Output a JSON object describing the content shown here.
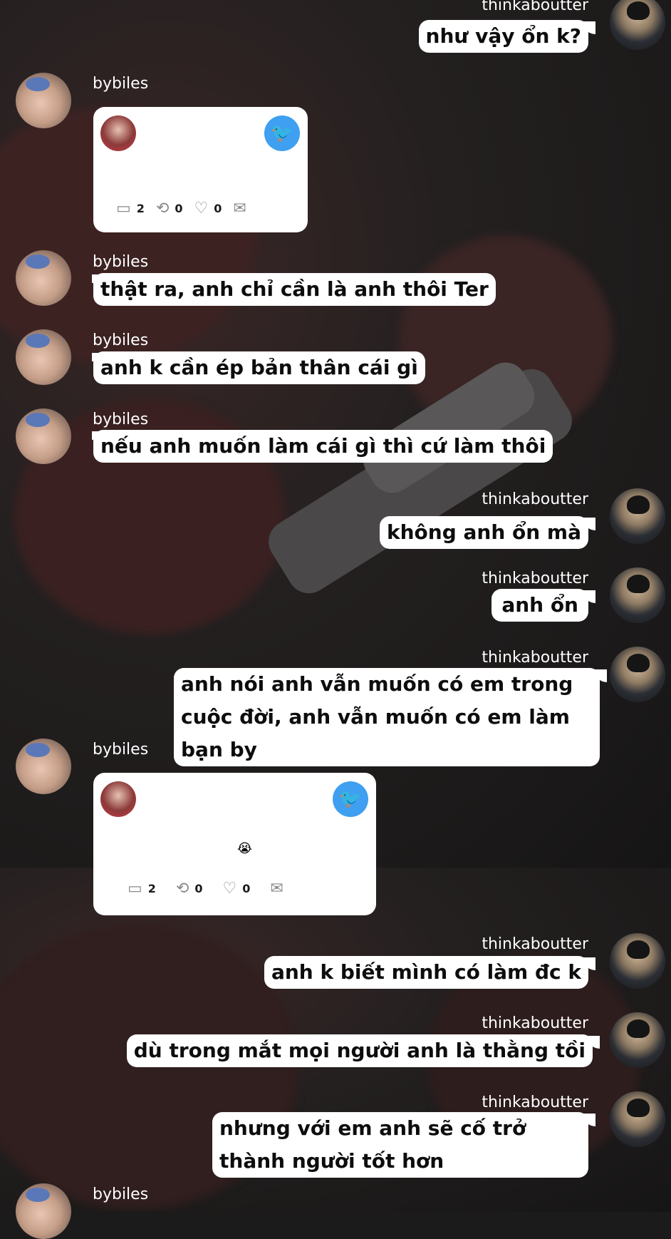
{
  "users": {
    "me": "thinkaboutter",
    "other": "bybiles"
  },
  "messages": [
    {
      "user": "thinkaboutter",
      "text": "như vậy ổn k?"
    },
    {
      "user": "bybiles",
      "tweet": {
        "text": "",
        "reply": "2",
        "retweet": "0",
        "like": "0"
      }
    },
    {
      "user": "bybiles",
      "text": "thật ra, anh chỉ cần là anh thôi Ter"
    },
    {
      "user": "bybiles",
      "text": "anh k cần ép bản thân cái gì"
    },
    {
      "user": "bybiles",
      "text": "nếu anh muốn làm cái gì thì cứ làm thôi"
    },
    {
      "user": "thinkaboutter",
      "text": "không anh ổn mà"
    },
    {
      "user": "thinkaboutter",
      "text": "anh ổn"
    },
    {
      "user": "thinkaboutter",
      "text": "anh nói anh vẫn muốn có em trong cuộc đời, anh vẫn muốn có em làm bạn by"
    },
    {
      "user": "bybiles",
      "tweet": {
        "text": "😭",
        "reply": "2",
        "retweet": "0",
        "like": "0"
      }
    },
    {
      "user": "thinkaboutter",
      "text": "anh k biết mình có làm đc k"
    },
    {
      "user": "thinkaboutter",
      "text": "dù trong mắt mọi người anh là thằng tồi"
    },
    {
      "user": "thinkaboutter",
      "text": "nhưng với em anh sẽ cố trở thành người tốt hơn"
    },
    {
      "user": "bybiles",
      "text": ""
    }
  ],
  "icons": {
    "reply": "comment-icon",
    "retweet": "retweet-icon",
    "like": "heart-icon",
    "share": "mail-icon",
    "twitter": "twitter-bird-icon"
  },
  "colors": {
    "bubble": "#ffffff",
    "twitter": "#3f9ff0",
    "username": "#ffffff"
  }
}
